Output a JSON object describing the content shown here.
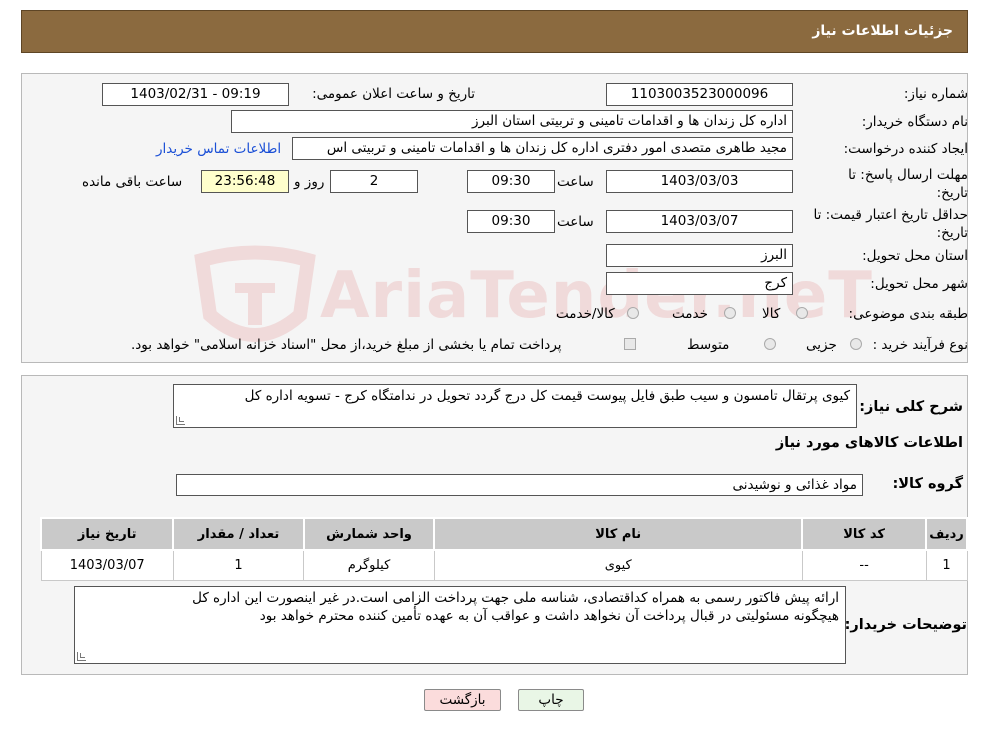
{
  "header": {
    "title": "جزئیات اطلاعات نیاز"
  },
  "watermark": {
    "text": "AriaTender.neT"
  },
  "form": {
    "need_number": {
      "label": "شماره نیاز:",
      "value": "1103003523000096"
    },
    "announce_datetime": {
      "label": "تاریخ و ساعت اعلان عمومی:",
      "value": "1403/02/31 - 09:19"
    },
    "buyer_org": {
      "label": "نام دستگاه خریدار:",
      "value": "اداره کل زندان ها و اقدامات تامینی و تربیتی استان البرز"
    },
    "requester": {
      "label": "ایجاد کننده درخواست:",
      "value": "مجید طاهری متصدی امور دفتری اداره کل زندان ها و اقدامات تامینی و تربیتی اس",
      "contact_link": "اطلاعات تماس خریدار"
    },
    "deadline": {
      "label": "مهلت ارسال پاسخ: تا تاریخ:",
      "date": "1403/03/03",
      "time_label": "ساعت",
      "time": "09:30",
      "days": "2",
      "days_label": "روز و",
      "remaining": "23:56:48",
      "remaining_label": "ساعت باقی مانده"
    },
    "price_validity": {
      "label": "حداقل تاریخ اعتبار قیمت: تا تاریخ:",
      "date": "1403/03/07",
      "time_label": "ساعت",
      "time": "09:30"
    },
    "province": {
      "label": "استان محل تحویل:",
      "value": "البرز"
    },
    "city": {
      "label": "شهر محل تحویل:",
      "value": "کرج"
    },
    "category": {
      "label": "طبقه بندی موضوعی:",
      "options": [
        "کالا",
        "خدمت",
        "کالا/خدمت"
      ]
    },
    "purchase_type": {
      "label": "نوع فرآیند خرید :",
      "options": [
        "جزیی",
        "متوسط"
      ],
      "note": "پرداخت تمام یا بخشی از مبلغ خرید،از محل \"اسناد خزانه اسلامی\" خواهد بود."
    }
  },
  "description": {
    "label": "شرح کلی نیاز:",
    "value": "کیوی پرتقال تامسون و سیب طبق فایل پیوست  قیمت کل درج گردد تحویل در ندامتگاه کرج - تسویه اداره کل"
  },
  "goods": {
    "title": "اطلاعات کالاهای مورد نیاز",
    "group_label": "گروه کالا:",
    "group_value": "مواد غذائی و نوشیدنی",
    "columns": [
      "ردیف",
      "کد کالا",
      "نام کالا",
      "واحد شمارش",
      "تعداد / مقدار",
      "تاریخ نیاز"
    ],
    "rows": [
      [
        "1",
        "--",
        "کیوی",
        "کیلوگرم",
        "1",
        "1403/03/07"
      ]
    ]
  },
  "buyer_notes": {
    "label": "توضیحات خریدار:",
    "line1": "ارائه پیش فاکتور رسمی به همراه کداقتصادی، شناسه ملی جهت پرداخت الزامی است.در غیر اینصورت این اداره کل",
    "line2": "هیچگونه مسئولیتی در قبال پرداخت آن نخواهد داشت و عواقب آن به عهده تأمین کننده محترم خواهد بود"
  },
  "buttons": {
    "print": "چاپ",
    "back": "بازگشت"
  }
}
